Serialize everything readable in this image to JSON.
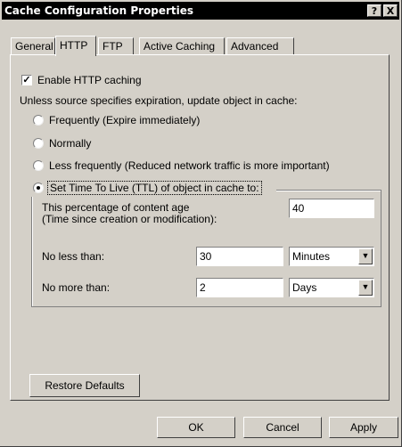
{
  "window": {
    "title": "Cache Configuration Properties",
    "help_btn": "?",
    "close_btn": "X"
  },
  "tabs": [
    {
      "label": "General"
    },
    {
      "label": "HTTP",
      "active": true
    },
    {
      "label": "FTP"
    },
    {
      "label": "Active Caching"
    },
    {
      "label": "Advanced"
    }
  ],
  "http": {
    "enable_caching_label": "Enable HTTP caching",
    "enable_caching_checked": true,
    "expiration_prompt": "Unless source specifies expiration, update object in cache:",
    "radios": [
      {
        "label": "Frequently (Expire immediately)",
        "checked": false
      },
      {
        "label": "Normally",
        "checked": false
      },
      {
        "label": "Less frequently (Reduced network traffic is more important)",
        "checked": false
      },
      {
        "label": "Set Time To Live (TTL) of object in cache to:",
        "checked": true
      }
    ],
    "ttl": {
      "percentage_label_1": "This percentage of content age",
      "percentage_label_2": "(Time since creation or modification):",
      "percentage_value": "40",
      "no_less_than_label": "No less than:",
      "no_less_than_value": "30",
      "no_less_than_unit": "Minutes",
      "no_more_than_label": "No more than:",
      "no_more_than_value": "2",
      "no_more_than_unit": "Days"
    },
    "restore_defaults_label": "Restore Defaults"
  },
  "footer": {
    "ok_label": "OK",
    "cancel_label": "Cancel",
    "apply_label": "Apply"
  }
}
